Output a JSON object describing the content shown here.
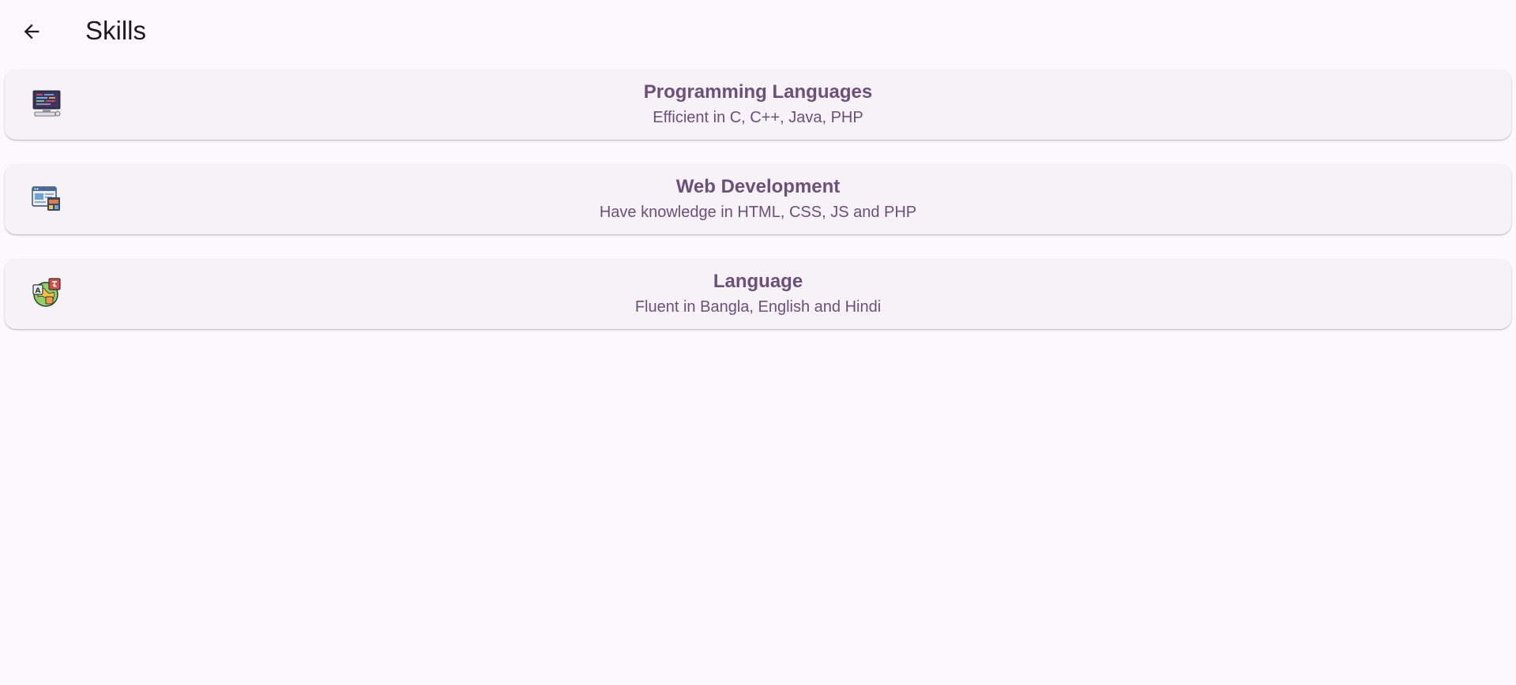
{
  "header": {
    "title": "Skills",
    "back_icon": "arrow-left-icon"
  },
  "skills": [
    {
      "title": "Programming Languages",
      "subtitle": "Efficient in C, C++, Java, PHP",
      "icon": "computer-monitor-icon"
    },
    {
      "title": "Web Development",
      "subtitle": "Have knowledge in HTML, CSS, JS and PHP",
      "icon": "web-layout-icon"
    },
    {
      "title": "Language",
      "subtitle": "Fluent in Bangla, English and Hindi",
      "icon": "language-globe-icon"
    }
  ],
  "colors": {
    "background": "#fdf7fe",
    "card": "#f7f1f8",
    "text_accent": "#6b5079",
    "title_text": "#1d1b20"
  }
}
